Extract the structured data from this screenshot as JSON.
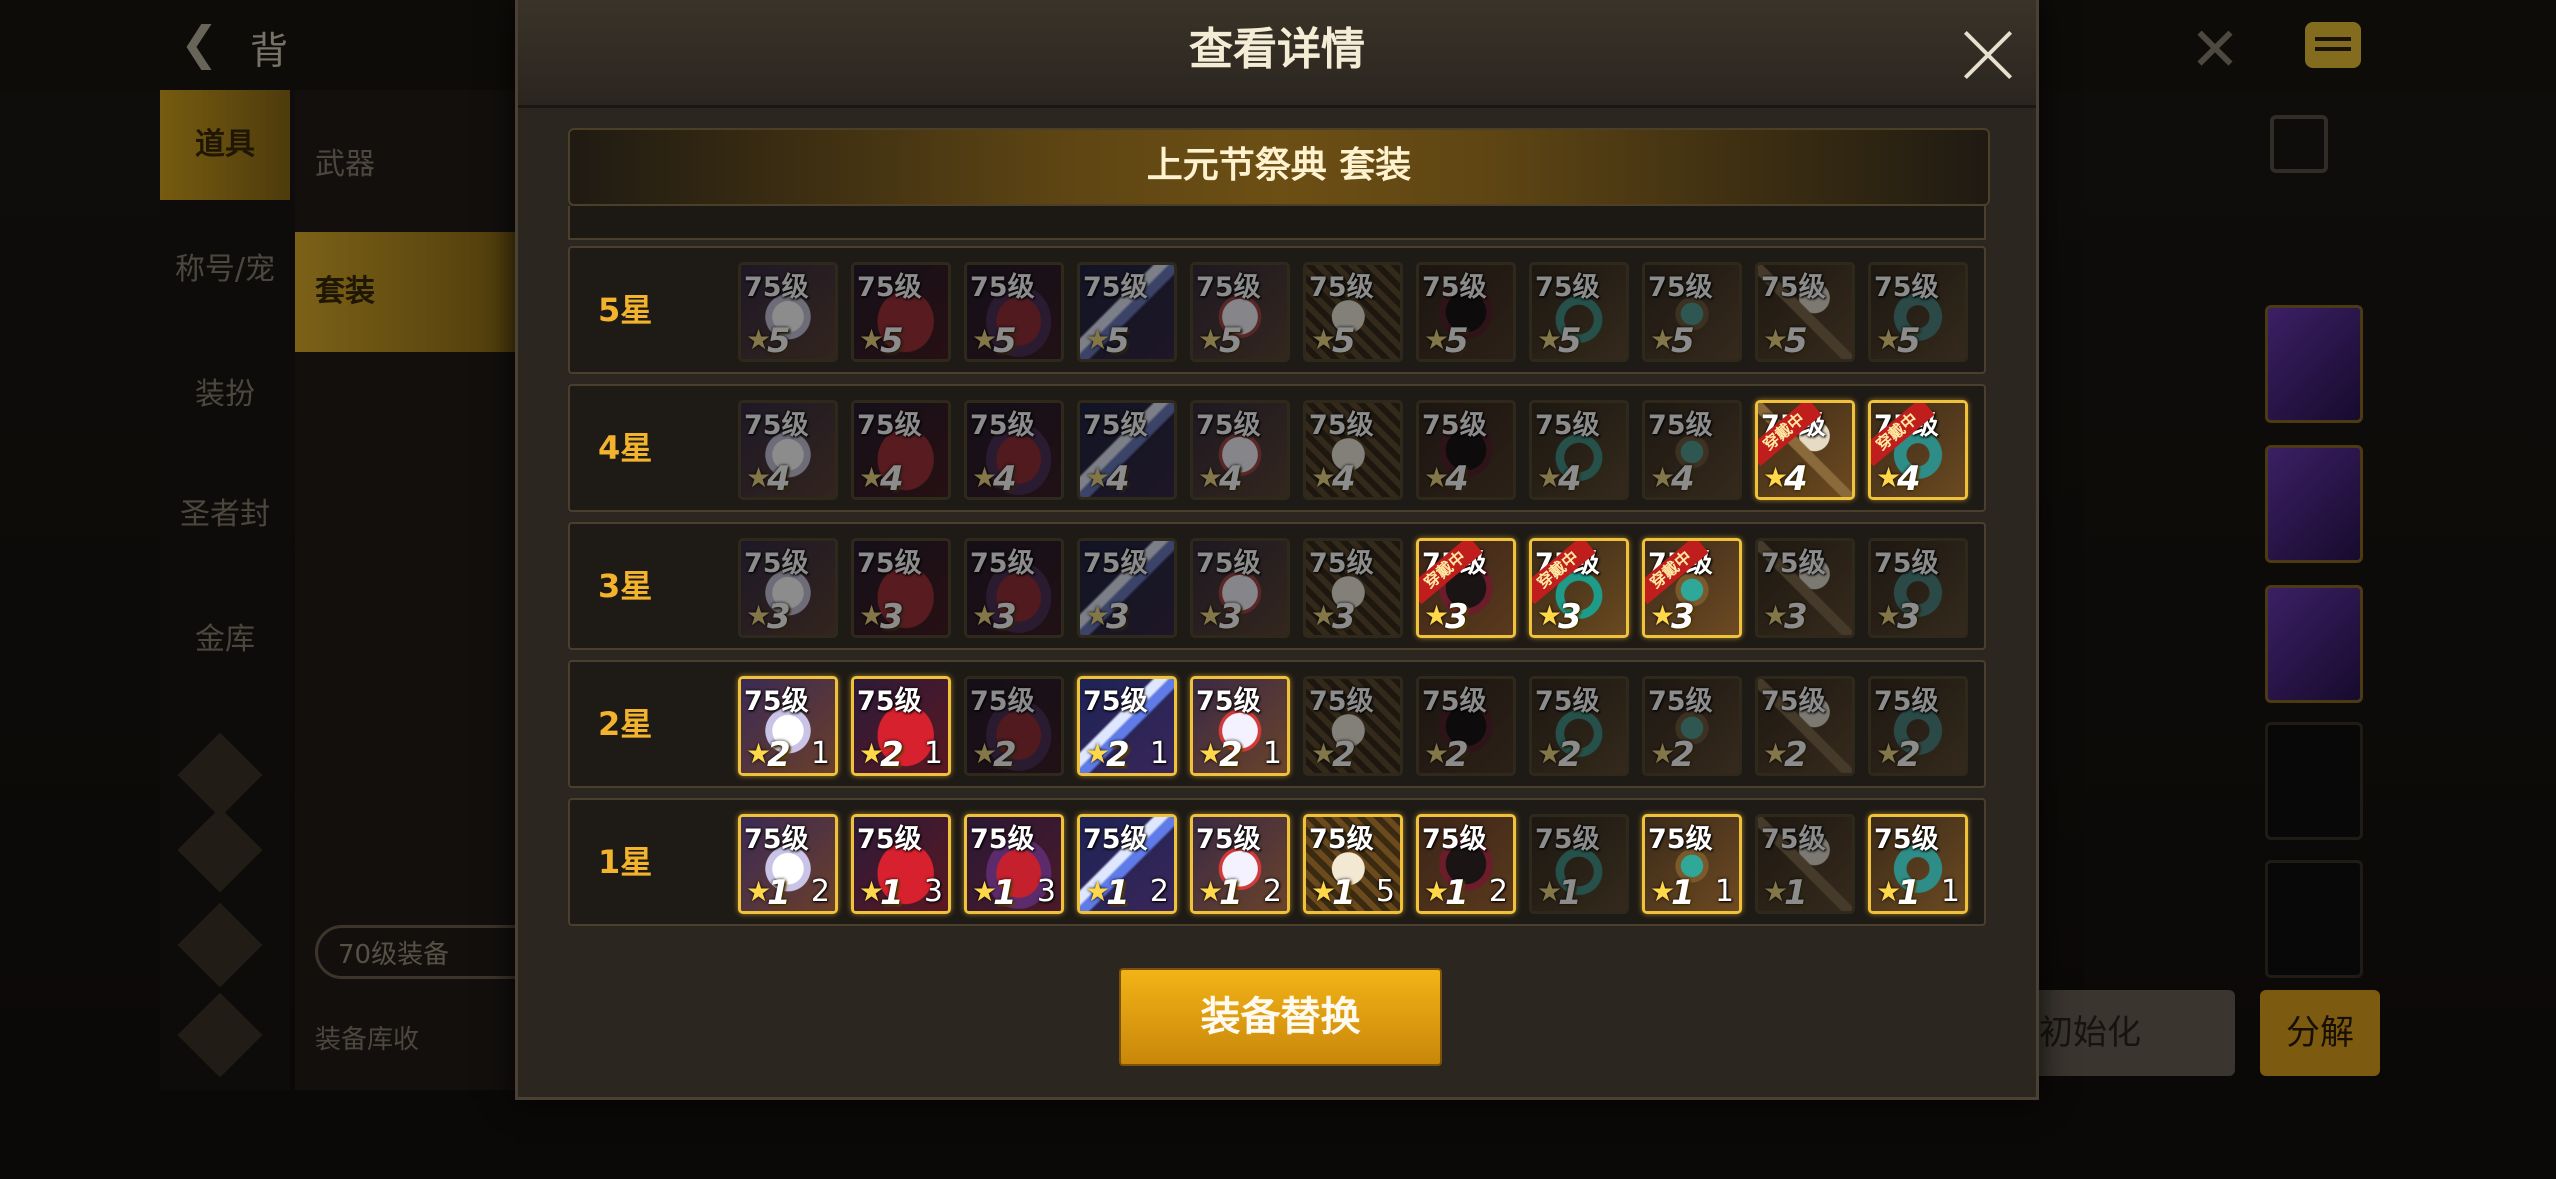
{
  "background": {
    "header_title": "背",
    "side_items": [
      {
        "label": "道具",
        "active": true
      },
      {
        "label": "称号/宠",
        "active": false
      },
      {
        "label": "装扮",
        "active": false
      },
      {
        "label": "圣者封",
        "active": false
      },
      {
        "label": "金库",
        "active": false
      }
    ],
    "sub_items": [
      {
        "label": "武器",
        "active": false
      },
      {
        "label": "套装",
        "active": true
      }
    ],
    "filter_pill": "70级装备",
    "storage_label": "装备库收",
    "init_button": "初始化",
    "decompose_button": "分解"
  },
  "modal": {
    "title": "查看详情",
    "set_name": "上元节祭典  套装",
    "swap_button": "装备替换",
    "equipped_tag": "穿戴中",
    "level_label": "75级",
    "star_glyph": "★",
    "slots": [
      {
        "icon": "shirt-icon",
        "art": "a-shirt"
      },
      {
        "icon": "red-coat-icon",
        "art": "a-redcoat"
      },
      {
        "icon": "cloak-icon",
        "art": "a-purplecoat"
      },
      {
        "icon": "blade-icon",
        "art": "a-blade"
      },
      {
        "icon": "glove-icon",
        "art": "a-glove"
      },
      {
        "icon": "chain-icon",
        "art": "a-chain"
      },
      {
        "icon": "dark-wing-icon",
        "art": "a-darkwing"
      },
      {
        "icon": "ring-icon",
        "art": "a-ring"
      },
      {
        "icon": "amulet-icon",
        "art": "a-amulet"
      },
      {
        "icon": "axe-icon",
        "art": "a-axe"
      },
      {
        "icon": "wreath-icon",
        "art": "a-wreath"
      }
    ],
    "rows": [
      {
        "label": "5星",
        "star": "5",
        "cells": [
          {
            "owned": false,
            "equipped": false,
            "count": ""
          },
          {
            "owned": false,
            "equipped": false,
            "count": ""
          },
          {
            "owned": false,
            "equipped": false,
            "count": ""
          },
          {
            "owned": false,
            "equipped": false,
            "count": ""
          },
          {
            "owned": false,
            "equipped": false,
            "count": ""
          },
          {
            "owned": false,
            "equipped": false,
            "count": ""
          },
          {
            "owned": false,
            "equipped": false,
            "count": ""
          },
          {
            "owned": false,
            "equipped": false,
            "count": ""
          },
          {
            "owned": false,
            "equipped": false,
            "count": ""
          },
          {
            "owned": false,
            "equipped": false,
            "count": ""
          },
          {
            "owned": false,
            "equipped": false,
            "count": ""
          }
        ]
      },
      {
        "label": "4星",
        "star": "4",
        "cells": [
          {
            "owned": false,
            "equipped": false,
            "count": ""
          },
          {
            "owned": false,
            "equipped": false,
            "count": ""
          },
          {
            "owned": false,
            "equipped": false,
            "count": ""
          },
          {
            "owned": false,
            "equipped": false,
            "count": ""
          },
          {
            "owned": false,
            "equipped": false,
            "count": ""
          },
          {
            "owned": false,
            "equipped": false,
            "count": ""
          },
          {
            "owned": false,
            "equipped": false,
            "count": ""
          },
          {
            "owned": false,
            "equipped": false,
            "count": ""
          },
          {
            "owned": false,
            "equipped": false,
            "count": ""
          },
          {
            "owned": true,
            "equipped": true,
            "count": ""
          },
          {
            "owned": true,
            "equipped": true,
            "count": ""
          }
        ]
      },
      {
        "label": "3星",
        "star": "3",
        "cells": [
          {
            "owned": false,
            "equipped": false,
            "count": ""
          },
          {
            "owned": false,
            "equipped": false,
            "count": ""
          },
          {
            "owned": false,
            "equipped": false,
            "count": ""
          },
          {
            "owned": false,
            "equipped": false,
            "count": ""
          },
          {
            "owned": false,
            "equipped": false,
            "count": ""
          },
          {
            "owned": false,
            "equipped": false,
            "count": ""
          },
          {
            "owned": true,
            "equipped": true,
            "count": ""
          },
          {
            "owned": true,
            "equipped": true,
            "count": ""
          },
          {
            "owned": true,
            "equipped": true,
            "count": ""
          },
          {
            "owned": false,
            "equipped": false,
            "count": ""
          },
          {
            "owned": false,
            "equipped": false,
            "count": ""
          }
        ]
      },
      {
        "label": "2星",
        "star": "2",
        "cells": [
          {
            "owned": true,
            "equipped": false,
            "count": "1"
          },
          {
            "owned": true,
            "equipped": false,
            "count": "1"
          },
          {
            "owned": false,
            "equipped": false,
            "count": ""
          },
          {
            "owned": true,
            "equipped": false,
            "count": "1"
          },
          {
            "owned": true,
            "equipped": false,
            "count": "1"
          },
          {
            "owned": false,
            "equipped": false,
            "count": ""
          },
          {
            "owned": false,
            "equipped": false,
            "count": ""
          },
          {
            "owned": false,
            "equipped": false,
            "count": ""
          },
          {
            "owned": false,
            "equipped": false,
            "count": ""
          },
          {
            "owned": false,
            "equipped": false,
            "count": ""
          },
          {
            "owned": false,
            "equipped": false,
            "count": ""
          }
        ]
      },
      {
        "label": "1星",
        "star": "1",
        "cells": [
          {
            "owned": true,
            "equipped": false,
            "count": "2"
          },
          {
            "owned": true,
            "equipped": false,
            "count": "3"
          },
          {
            "owned": true,
            "equipped": false,
            "count": "3"
          },
          {
            "owned": true,
            "equipped": false,
            "count": "2"
          },
          {
            "owned": true,
            "equipped": false,
            "count": "2"
          },
          {
            "owned": true,
            "equipped": false,
            "count": "5"
          },
          {
            "owned": true,
            "equipped": false,
            "count": "2"
          },
          {
            "owned": false,
            "equipped": false,
            "count": ""
          },
          {
            "owned": true,
            "equipped": false,
            "count": "1"
          },
          {
            "owned": false,
            "equipped": false,
            "count": ""
          },
          {
            "owned": true,
            "equipped": false,
            "count": "1"
          }
        ]
      }
    ]
  }
}
